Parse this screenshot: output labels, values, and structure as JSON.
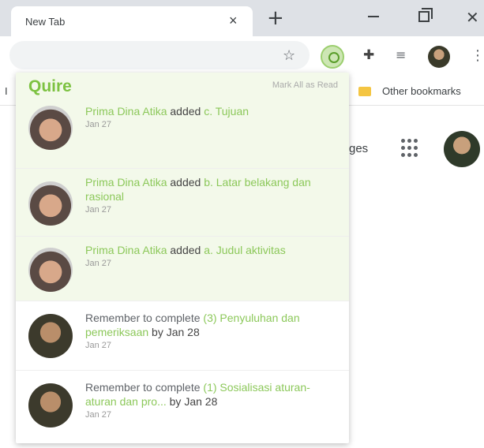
{
  "browser": {
    "tab_title": "New Tab",
    "tab_close": "×",
    "new_tab": "+",
    "window_controls": {
      "minimize": "",
      "maximize": "",
      "close": "✕"
    },
    "toolbar_icons": [
      "star-icon",
      "quire-extension-icon",
      "puzzle-icon",
      "media-control-icon",
      "profile-avatar",
      "menu-icon"
    ],
    "bookmarks": {
      "left_partial": "I",
      "other_bookmarks": "Other bookmarks"
    },
    "ntp": {
      "partial_text": "ges"
    }
  },
  "popup": {
    "logo": "Quire",
    "mark_all": "Mark All as Read",
    "notifications": [
      {
        "user": "Prima Dina Atika",
        "verb": "added",
        "item": "c. Tujuan",
        "prefix": "",
        "suffix": "",
        "date": "Jan 27",
        "unread": true
      },
      {
        "user": "Prima Dina Atika",
        "verb": "added",
        "item": "b. Latar belakang dan rasional",
        "prefix": "",
        "suffix": "",
        "date": "Jan 27",
        "unread": true
      },
      {
        "user": "Prima Dina Atika",
        "verb": "added",
        "item": "a. Judul aktivitas",
        "prefix": "",
        "suffix": "",
        "date": "Jan 27",
        "unread": true
      },
      {
        "user": "",
        "verb": "",
        "prefix": "Remember to complete",
        "item": "(3) Penyuluhan dan pemeriksaan",
        "suffix": "by Jan 28",
        "date": "Jan 27",
        "unread": false
      },
      {
        "user": "",
        "verb": "",
        "prefix": "Remember to complete",
        "item": "(1) Sosialisasi aturan-aturan dan pro...",
        "suffix": "by Jan 28",
        "date": "Jan 27",
        "unread": false
      }
    ]
  },
  "colors": {
    "accent": "#7dc242",
    "unread_bg": "#f3f9ea",
    "tabstrip": "#dee1e6"
  }
}
